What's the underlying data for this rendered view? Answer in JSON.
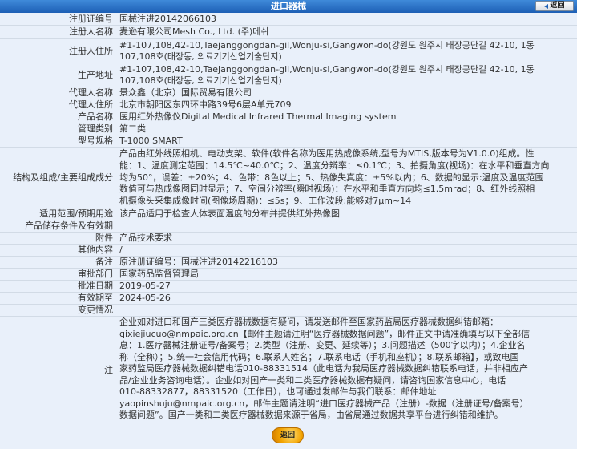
{
  "header": {
    "title": "进口器械",
    "back_label": "返回"
  },
  "fields": [
    {
      "label": "注册证编号",
      "value": "国械注进20142066103"
    },
    {
      "label": "注册人名称",
      "value": "麦逊有限公司Mesh Co., Ltd. (주)메쉬"
    },
    {
      "label": "注册人住所",
      "value": "#1-107,108,42-10,Taejanggongdan-gil,Wonju-si,Gangwon-do(강원도 원주시 태장공단길 42-10, 1동\n107,108호(태장동, 의료기기산업기술단지)"
    },
    {
      "label": "生产地址",
      "value": "#1-107,108,42-10,Taejanggongdan-gil,Wonju-si,Gangwon-do(강원도 원주시 태장공단길 42-10, 1동\n107,108호(태장동, 의료기기산업기술단지)"
    },
    {
      "label": "代理人名称",
      "value": "景众鑫（北京）国际贸易有限公司"
    },
    {
      "label": "代理人住所",
      "value": "北京市朝阳区东四环中路39号6层A单元709"
    },
    {
      "label": "产品名称",
      "value": "医用红外热像仪Digital Medical Infrared Thermal Imaging system"
    },
    {
      "label": "管理类别",
      "value": "第二类"
    },
    {
      "label": "型号规格",
      "value": "T-1000 SMART"
    },
    {
      "label": "结构及组成/主要组成成分",
      "value": "产品由红外线照相机、电动支架、软件(软件名称为医用热成像系统,型号为MTIS,版本号为V1.0.0)组成。性\n能：1、温度测定范围：14.5℃~40.0℃；2、温度分辨率：≤0.1℃；3、拍摄角度(视场)：在水平和垂直方向\n均为50°，误差：±20%；4、色带：8色以上；5、热像失真度：±5%以内；6、数据的显示:温度及温度范围\n数值可与热成像图同时显示；7、空间分辨率(瞬时视场)：在水平和垂直方向均≤1.5mrad；8、红外线照相\n机摄像头采集成像时间(图像场周期)：≤5s；9、工作波段:能够对7μm~14"
    },
    {
      "label": "适用范围/预期用途",
      "value": "该产品适用于检查人体表面温度的分布并提供红外热像图"
    },
    {
      "label": "产品储存条件及有效期",
      "value": ""
    },
    {
      "label": "附件",
      "value": "产品技术要求"
    },
    {
      "label": "其他内容",
      "value": "/"
    },
    {
      "label": "备注",
      "value": "原注册证编号：国械注进20142216103"
    },
    {
      "label": "审批部门",
      "value": "国家药品监督管理局"
    },
    {
      "label": "批准日期",
      "value": "2019-05-27"
    },
    {
      "label": "有效期至",
      "value": "2024-05-26"
    },
    {
      "label": "变更情况",
      "value": ""
    },
    {
      "label": "注",
      "value": "企业如对进口和国产三类医疗器械数据有疑问，请发送邮件至国家药监局医疗器械数据纠错邮箱：\nqixiejiucuo@nmpaic.org.cn【邮件主题请注明“医疗器械数据问题”，邮件正文中请准确填写以下全部信\n息：1.医疗器械注册证号/备案号；2.类型（注册、变更、延续等）；3.问题描述（500字以内）；4.企业名\n称（全称）；5.统一社会信用代码；6.联系人姓名；7.联系电话（手机和座机）；8.联系邮箱】，或致电国\n家药监局医疗器械数据纠错电话010-88331514（此电话为我局医疗器械数据纠错联系电话，并非相应产\n品/企业业务咨询电话）。企业如对国产一类和二类医疗器械数据有疑问，请咨询国家信息中心，电话\n010-88332877，88331520（工作日），也可通过发邮件与我们联系：邮件地址\nyaopinshuju@nmpaic.org.cn，邮件主题请注明“进口医疗器械产品（注册）-数据（注册证号/备案号）\n数据问题”。国产一类和二类医疗器械数据来源于省局，由省局通过数据共享平台进行纠错和维护。"
    }
  ],
  "footer": {
    "back_label": "返回"
  }
}
